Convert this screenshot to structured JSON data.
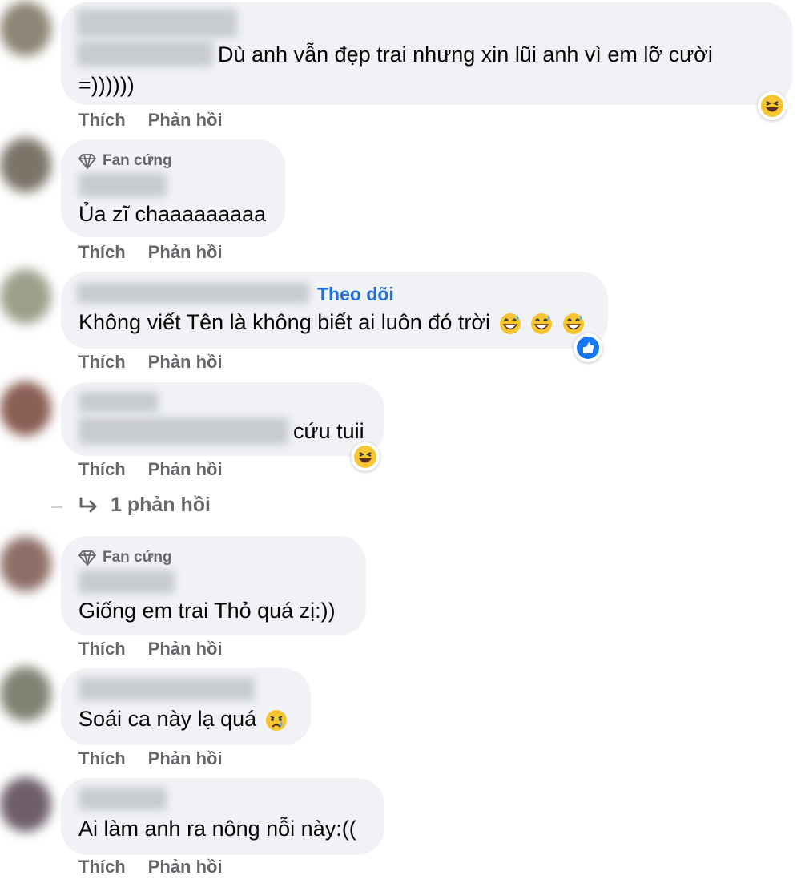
{
  "comments": [
    {
      "text_line1": "Dù anh vẫn đẹp trai nhưng xin lũi anh vì em lỡ cười",
      "text_line2": "=))))))",
      "actions": {
        "like": "Thích",
        "reply": "Phản hồi"
      },
      "reaction": "haha-icon"
    },
    {
      "badge": "Fan cứng",
      "text": "Ủa zĩ chaaaaaaaaa",
      "actions": {
        "like": "Thích",
        "reply": "Phản hồi"
      }
    },
    {
      "follow": "Theo dõi",
      "text": "Không viết Tên là không biết ai luôn đó trời",
      "actions": {
        "like": "Thích",
        "reply": "Phản hồi"
      },
      "reaction": "like-icon"
    },
    {
      "text": "cứu tuii",
      "actions": {
        "like": "Thích",
        "reply": "Phản hồi"
      },
      "reaction": "haha-icon"
    },
    {
      "badge": "Fan cứng",
      "text": "Giống em trai Thỏ quá zị:))",
      "actions": {
        "like": "Thích",
        "reply": "Phản hồi"
      }
    },
    {
      "text": "Soái ca này lạ quá",
      "actions": {
        "like": "Thích",
        "reply": "Phản hồi"
      }
    },
    {
      "text": "Ai làm anh ra nông nỗi này:((",
      "actions": {
        "like": "Thích",
        "reply": "Phản hồi"
      }
    }
  ],
  "reply_count": "1 phản hồi",
  "colors": {
    "bubble": "#f0f2f5",
    "meta": "#65676b",
    "follow": "#216fdb",
    "like": "#1877f2"
  }
}
